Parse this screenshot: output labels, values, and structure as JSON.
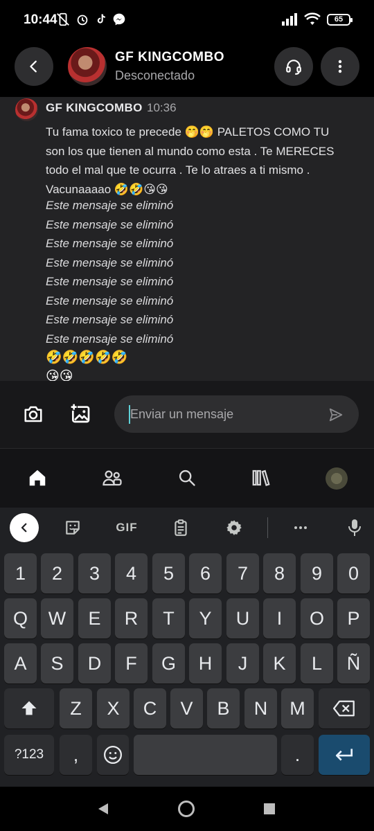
{
  "status_bar": {
    "time": "10:44",
    "battery": "65"
  },
  "header": {
    "contact_name": "GF KINGCOMBO",
    "contact_status": "Desconectado"
  },
  "message": {
    "author": "GF KINGCOMBO",
    "time": "10:36",
    "text": "Tu fama toxico te precede 🤭🤭 PALETOS COMO TU son los que tienen al mundo como esta . Te MERECES todo el mal que te ocurra . Te lo atraes a ti mismo . Vacunaaaao 🤣🤣😘😘",
    "deleted_notices": [
      "Este mensaje se eliminó",
      "Este mensaje se eliminó",
      "Este mensaje se eliminó",
      "Este mensaje se eliminó",
      "Este mensaje se eliminó",
      "Este mensaje se eliminó",
      "Este mensaje se eliminó",
      "Este mensaje se eliminó"
    ],
    "emoji_line_1": "🤣🤣🤣🤣🤣",
    "emoji_line_2": "😘😘"
  },
  "composer": {
    "placeholder": "Enviar un mensaje"
  },
  "bottom_nav": [
    "home-icon",
    "friends-icon",
    "search-icon",
    "library-icon",
    "profile-avatar"
  ],
  "keyboard": {
    "toolbar": {
      "gif_label": "GIF"
    },
    "row_numbers": [
      "1",
      "2",
      "3",
      "4",
      "5",
      "6",
      "7",
      "8",
      "9",
      "0"
    ],
    "row_1": [
      "Q",
      "W",
      "E",
      "R",
      "T",
      "Y",
      "U",
      "I",
      "O",
      "P"
    ],
    "row_2": [
      "A",
      "S",
      "D",
      "F",
      "G",
      "H",
      "J",
      "K",
      "L",
      "Ñ"
    ],
    "row_3": [
      "Z",
      "X",
      "C",
      "V",
      "B",
      "N",
      "M"
    ],
    "symbols_label": "?123",
    "comma": ",",
    "period": "."
  },
  "colors": {
    "accent_caret": "#5fd2d8",
    "enter_key": "#1a4b6e"
  }
}
